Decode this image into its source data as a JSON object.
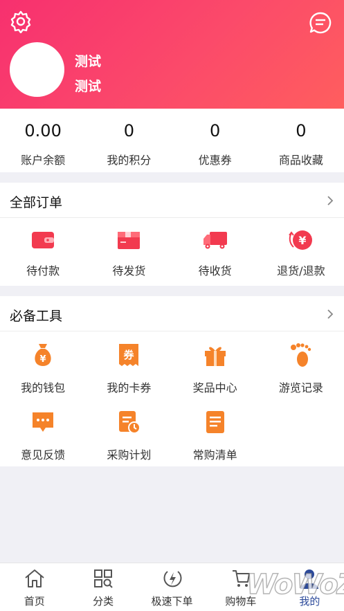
{
  "user": {
    "name": "测试",
    "subtitle": "测试"
  },
  "stats": [
    {
      "value": "0.00",
      "label": "账户余额"
    },
    {
      "value": "0",
      "label": "我的积分"
    },
    {
      "value": "0",
      "label": "优惠券"
    },
    {
      "value": "0",
      "label": "商品收藏"
    }
  ],
  "orders": {
    "title": "全部订单",
    "items": [
      {
        "label": "待付款",
        "icon": "wallet-icon"
      },
      {
        "label": "待发货",
        "icon": "package-icon"
      },
      {
        "label": "待收货",
        "icon": "truck-icon"
      },
      {
        "label": "退货/退款",
        "icon": "refund-icon"
      }
    ]
  },
  "tools": {
    "title": "必备工具",
    "items": [
      {
        "label": "我的钱包",
        "icon": "money-bag-icon"
      },
      {
        "label": "我的卡券",
        "icon": "coupon-icon",
        "glyph": "券"
      },
      {
        "label": "奖品中心",
        "icon": "gift-icon"
      },
      {
        "label": "游览记录",
        "icon": "footprint-icon"
      },
      {
        "label": "意见反馈",
        "icon": "feedback-icon"
      },
      {
        "label": "采购计划",
        "icon": "purchase-plan-icon"
      },
      {
        "label": "常购清单",
        "icon": "list-icon"
      }
    ]
  },
  "nav": [
    {
      "label": "首页",
      "icon": "home-icon"
    },
    {
      "label": "分类",
      "icon": "category-icon"
    },
    {
      "label": "极速下单",
      "icon": "lightning-icon"
    },
    {
      "label": "购物车",
      "icon": "cart-icon"
    },
    {
      "label": "我的",
      "icon": "user-icon",
      "active": true
    }
  ],
  "colors": {
    "brand": "#f7306f",
    "icon_red": "#f23a4f",
    "icon_orange": "#f5832a",
    "active_nav": "#2c4a9a"
  },
  "watermark": "WoWoZ"
}
